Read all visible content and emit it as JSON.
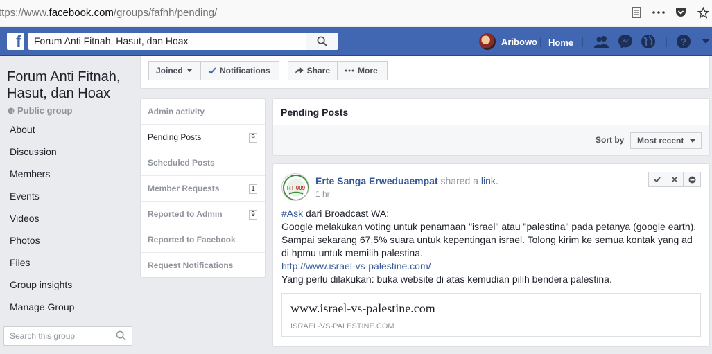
{
  "browser": {
    "url_dim": "ttps://www.",
    "url_main": "facebook.com",
    "url_rest": "/groups/fafhh/pending/"
  },
  "fb": {
    "logo": "f",
    "search_value": "Forum Anti Fitnah, Hasut, dan Hoax",
    "user_name": "Aribowo",
    "home_label": "Home"
  },
  "group": {
    "title": "Forum Anti Fitnah, Hasut, dan Hoax",
    "privacy": "Public group",
    "nav": [
      "About",
      "Discussion",
      "Members",
      "Events",
      "Videos",
      "Photos",
      "Files",
      "Group insights",
      "Manage Group"
    ],
    "search_placeholder": "Search this group"
  },
  "actions": {
    "joined": "Joined",
    "notifications": "Notifications",
    "share": "Share",
    "more": "More"
  },
  "admin_menu": [
    {
      "label": "Admin activity",
      "count": ""
    },
    {
      "label": "Pending Posts",
      "count": "9"
    },
    {
      "label": "Scheduled Posts",
      "count": ""
    },
    {
      "label": "Member Requests",
      "count": "1"
    },
    {
      "label": "Reported to Admin",
      "count": "9"
    },
    {
      "label": "Reported to Facebook",
      "count": ""
    },
    {
      "label": "Request Notifications",
      "count": ""
    }
  ],
  "pending": {
    "header": "Pending Posts",
    "sort_label": "Sort by",
    "sort_value": "Most recent"
  },
  "post": {
    "avatar_text": "RT 009",
    "author": "Erte Sanga Erweduaempat",
    "shared_text": "shared a",
    "link_word": "link.",
    "time": "1 hr",
    "hashtag": "#Ask",
    "line1_rest": " dari Broadcast WA:",
    "paragraph": "Google melakukan voting untuk penamaan \"israel\" atau \"palestina\" pada petanya (google earth). Sampai sekarang 67,5% suara untuk kepentingan israel. Tolong kirim ke semua kontak yang ad di hpmu untuk memilih palestina.",
    "url": "http://www.israel-vs-palestine.com/",
    "closing": "Yang perlu dilakukan: buka website di atas kemudian pilih bendera palestina.",
    "preview_title": "www.israel-vs-palestine.com",
    "preview_domain": "ISRAEL-VS-PALESTINE.COM"
  }
}
